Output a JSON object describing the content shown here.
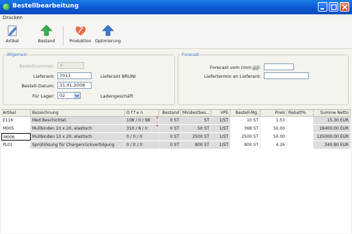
{
  "window": {
    "title": "Bestellbearbeitung"
  },
  "menu": {
    "items": [
      "Drucken"
    ]
  },
  "toolbar": {
    "buttons": [
      {
        "label": "Artikel",
        "icon": "pencil-icon"
      },
      {
        "label": "Bestand",
        "icon": "green-up-arrow-icon"
      },
      {
        "label": "Produktion",
        "icon": "heart-icon"
      },
      {
        "label": "Optimierung",
        "icon": "blue-up-arrow-icon"
      }
    ]
  },
  "allgemein": {
    "title": "Allgemein",
    "bestellnummer_label": "Bestellnummer:",
    "bestellnummer_value": "#",
    "lieferant_label": "Lieferant:",
    "lieferant_value": "7011",
    "lieferant_name": "Lieferant BRUNI",
    "datum_label": "Bestell-Datum:",
    "datum_value": "31.01.2008",
    "lager_label": "Für Lager:",
    "lager_value": "02",
    "lager_name": "Ladengeschäft"
  },
  "forecast": {
    "title": "Forecast",
    "vom_label": "Forecast vom (mm.jjjj):",
    "vom_value": "",
    "liefertermin_label": "Liefertermin an Lieferant:",
    "liefertermin_value": ""
  },
  "table": {
    "columns": [
      "Artikel",
      "Bezeichnung",
      "O f f e n",
      "Bestand",
      "Mindestbes...",
      "VPE",
      "Bestell-Mg.",
      "Preis",
      "Rabatt%",
      "Summe Netto"
    ],
    "rows": [
      [
        "E116",
        "Med.Beschichtet",
        "108 / 0 / 98",
        "0 ST",
        "ST",
        "1/ST",
        "10 ST",
        "1.53",
        "",
        "15.30 EUR"
      ],
      [
        "M005",
        "Mullbinden 10 x 20, elastisch",
        "310 / 8 / 0",
        "0 ST",
        "50 ST",
        "1/ST",
        "368 ST",
        "50.00",
        "",
        "18400.00 EUR"
      ],
      [
        "M006",
        "Mullbinden 10 x 20, elastisch",
        "0 / 0 / 0",
        "0 ST",
        "2500 ST",
        "1/ST",
        "2500 ST",
        "50.00",
        "",
        "125000.00 EUR"
      ],
      [
        "PL01",
        "Sprühlösung für Chargenrückverfolgung",
        "0 / 0 / 0",
        "0 ST",
        "800 ST",
        "1/ST",
        "800 ST",
        "4.26",
        "",
        "340.80 EUR"
      ]
    ]
  }
}
